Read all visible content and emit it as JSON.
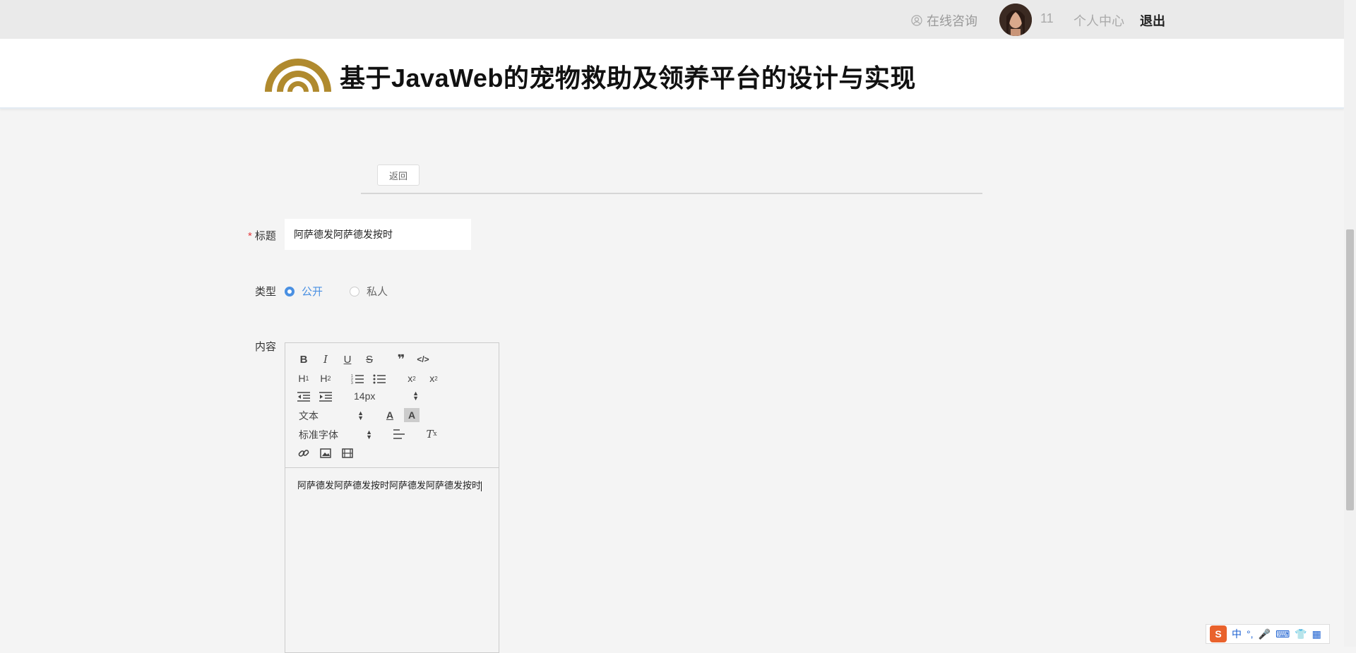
{
  "topbar": {
    "consult_label": "在线咨询",
    "username": "11",
    "user_center_label": "个人中心",
    "logout_label": "退出"
  },
  "header": {
    "site_title": "基于JavaWeb的宠物救助及领养平台的设计与实现"
  },
  "toolbar_top": {
    "back_label": "返回"
  },
  "form": {
    "title_label": "标题",
    "title_value": "阿萨德发阿萨德发按时",
    "type_label": "类型",
    "type_options": [
      "公开",
      "私人"
    ],
    "type_selected": "公开",
    "content_label": "内容"
  },
  "editor": {
    "size_value": "14px",
    "header_value": "文本",
    "font_value": "标准字体",
    "content": "阿萨德发阿萨德发按时阿萨德发阿萨德发按时"
  },
  "ime": {
    "logo": "S",
    "lang": "中"
  },
  "colors": {
    "accent": "#4a90e2",
    "required": "#e4393c",
    "logo_gold": "#b08a2e"
  }
}
